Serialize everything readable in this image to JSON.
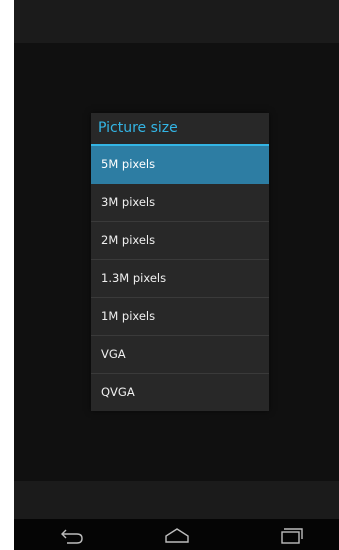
{
  "dialog": {
    "title": "Picture size",
    "options": [
      {
        "label": "5M pixels",
        "selected": true
      },
      {
        "label": "3M pixels",
        "selected": false
      },
      {
        "label": "2M pixels",
        "selected": false
      },
      {
        "label": "1.3M pixels",
        "selected": false
      },
      {
        "label": "1M pixels",
        "selected": false
      },
      {
        "label": "VGA",
        "selected": false
      },
      {
        "label": "QVGA",
        "selected": false
      }
    ]
  },
  "navbar": {
    "icons": [
      "back-icon",
      "home-icon",
      "recent-apps-icon"
    ]
  },
  "colors": {
    "accent": "#33b5e5",
    "selected_row": "#2d7da3",
    "dialog_bg": "#282828",
    "screen_bg": "#101010"
  }
}
